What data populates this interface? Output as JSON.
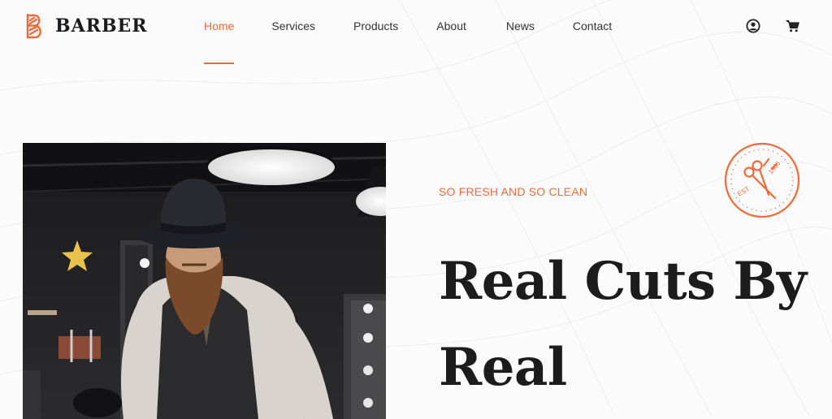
{
  "brand": {
    "name": "BARBER",
    "logo_icon": "barber-pole-logo-icon"
  },
  "nav": {
    "items": [
      {
        "label": "Home",
        "active": true
      },
      {
        "label": "Services"
      },
      {
        "label": "Products"
      },
      {
        "label": "About"
      },
      {
        "label": "News"
      },
      {
        "label": "Contact"
      }
    ]
  },
  "header_icons": [
    "user-icon",
    "cart-icon"
  ],
  "hero": {
    "tagline": "SO FRESH AND SO CLEAN",
    "headline": "Real Cuts By Real",
    "badge": {
      "text_left": "EST.",
      "text_right": "1986",
      "icon": "scissors-icon"
    }
  },
  "colors": {
    "accent": "#ee6a3a",
    "text": "#1c1c1c",
    "background": "#fbfbfb"
  }
}
